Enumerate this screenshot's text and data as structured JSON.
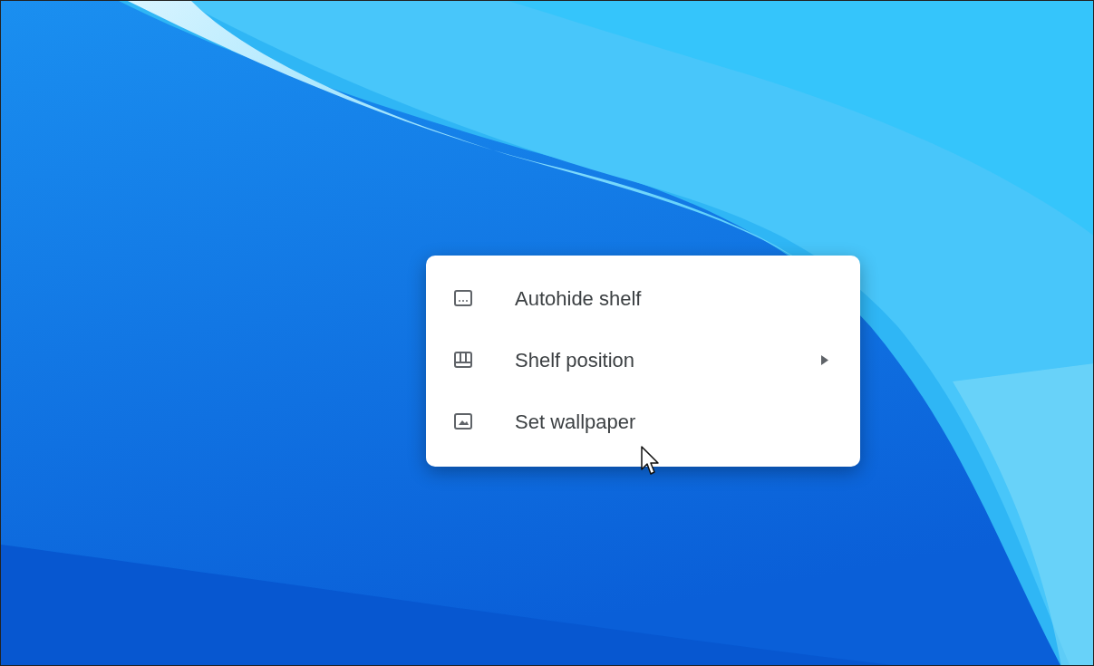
{
  "context_menu": {
    "items": [
      {
        "kind": "autohide",
        "label": "Autohide shelf",
        "submenu": false
      },
      {
        "kind": "position",
        "label": "Shelf position",
        "submenu": true
      },
      {
        "kind": "wallpaper",
        "label": "Set wallpaper",
        "submenu": false
      }
    ]
  }
}
